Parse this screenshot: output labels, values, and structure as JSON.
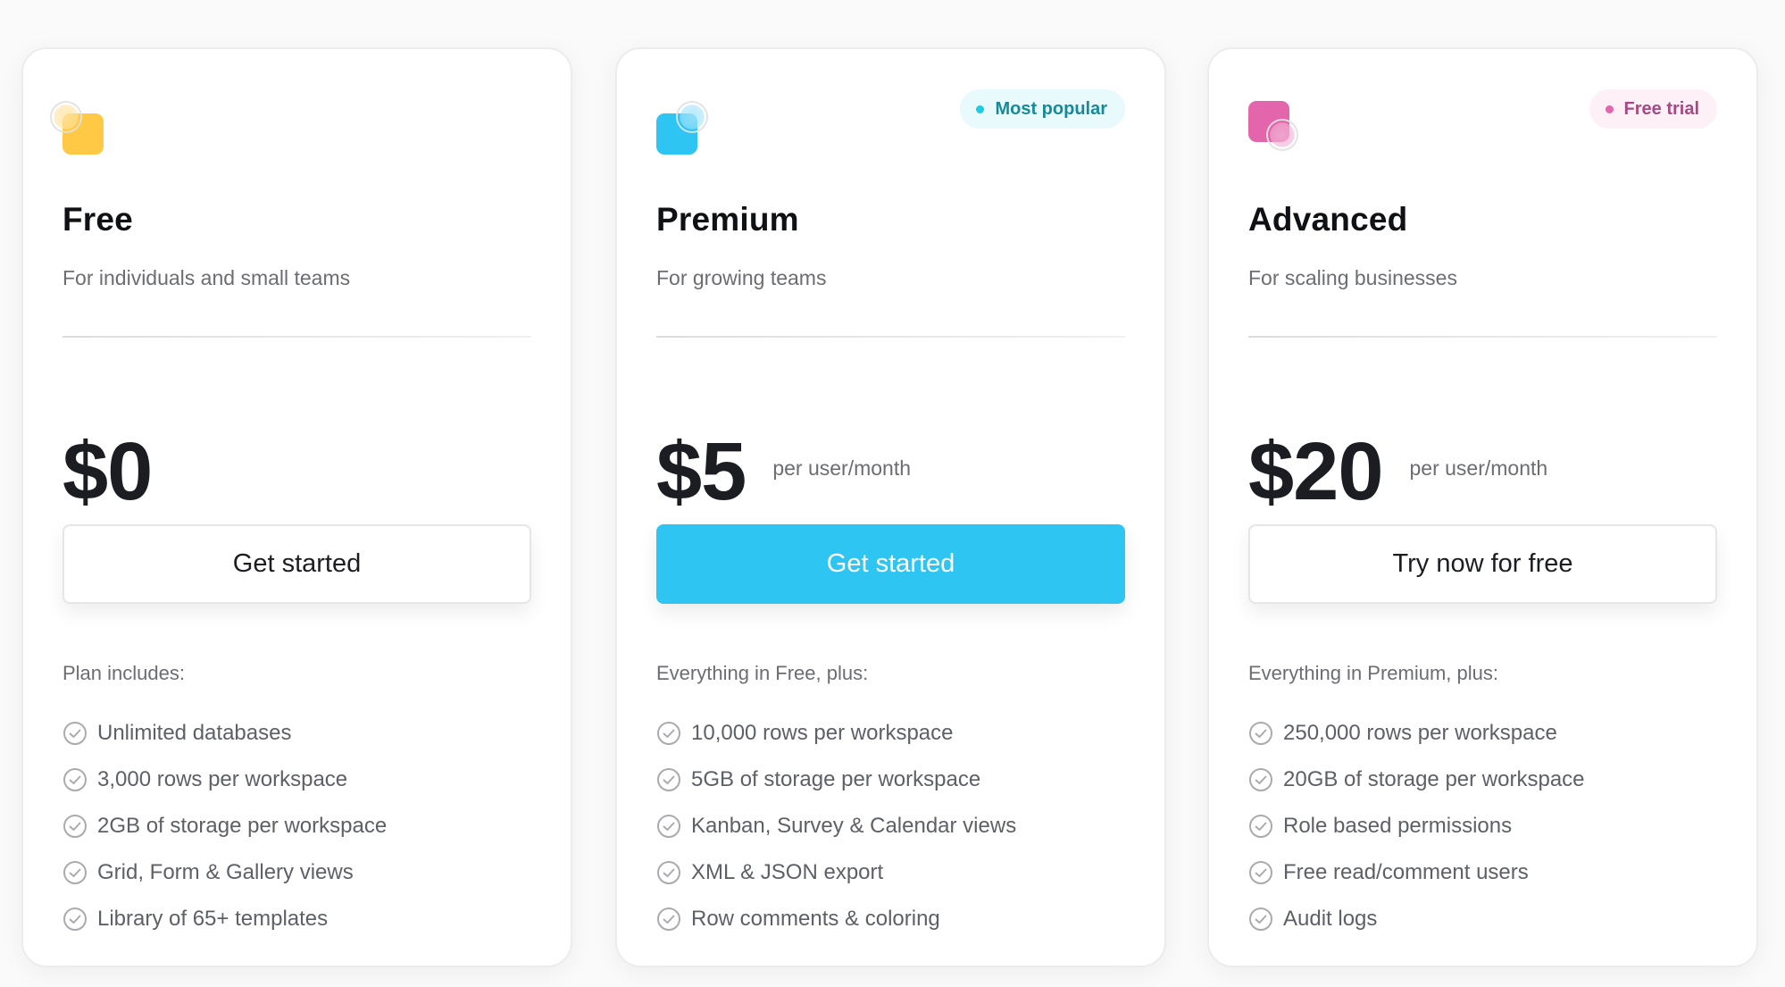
{
  "plans": [
    {
      "id": "free",
      "icon": "plan-shape-icon",
      "icon_color": "#ffc845",
      "icon_overlay_color": "#ffe3a3",
      "badge": null,
      "title": "Free",
      "subtitle": "For individuals and small teams",
      "price": "$0",
      "price_unit": "",
      "cta_label": "Get started",
      "cta_style": "outline",
      "includes_label": "Plan includes:",
      "features": [
        "Unlimited databases",
        "3,000 rows per workspace",
        "2GB of storage per workspace",
        "Grid, Form & Gallery views",
        "Library of 65+ templates"
      ]
    },
    {
      "id": "premium",
      "icon": "plan-shape-icon",
      "icon_color": "#2ec5f2",
      "icon_overlay_color": "#a6e4fa",
      "badge": {
        "label": "Most popular",
        "text_color": "#178a99",
        "bg_color": "#e8fafc",
        "dot_color": "#1ecbe0"
      },
      "title": "Premium",
      "subtitle": "For growing teams",
      "price": "$5",
      "price_unit": "per user/month",
      "cta_label": "Get started",
      "cta_style": "filled",
      "includes_label": "Everything in Free, plus:",
      "features": [
        "10,000 rows per workspace",
        "5GB of storage per workspace",
        "Kanban, Survey & Calendar views",
        "XML & JSON export",
        "Row comments & coloring"
      ]
    },
    {
      "id": "advanced",
      "icon": "plan-shape-icon",
      "icon_color": "#e366ad",
      "icon_overlay_color": "#f2b3d6",
      "badge": {
        "label": "Free trial",
        "text_color": "#a64a84",
        "bg_color": "#fdf0f7",
        "dot_color": "#e366ad"
      },
      "title": "Advanced",
      "subtitle": "For scaling businesses",
      "price": "$20",
      "price_unit": "per user/month",
      "cta_label": "Try now for free",
      "cta_style": "outline",
      "includes_label": "Everything in Premium, plus:",
      "features": [
        "250,000 rows per workspace",
        "20GB of storage per workspace",
        "Role based permissions",
        "Free read/comment users",
        "Audit logs"
      ]
    }
  ],
  "feature_icon": "check-circle-icon",
  "colors": {
    "accent": "#2ec5f2",
    "text_primary": "#1c1d22",
    "text_secondary": "#6b6d73",
    "check_icon": "#a9abb0"
  }
}
